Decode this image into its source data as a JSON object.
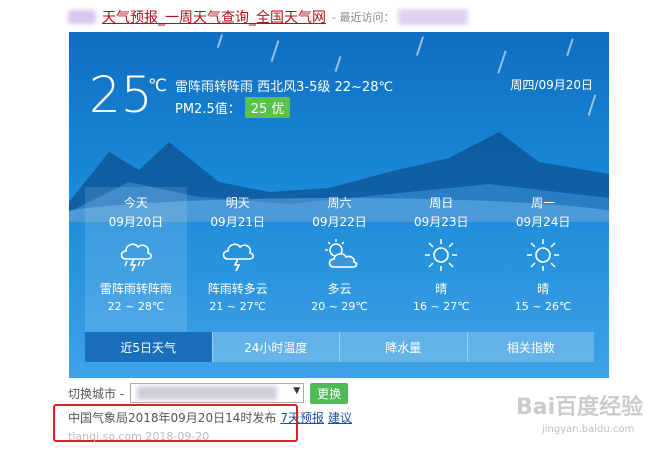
{
  "header": {
    "site_title": "天气预报_一周天气查询_全国天气网",
    "recent_label": "- 最近访问："
  },
  "current": {
    "temperature": "25",
    "unit": "℃",
    "summary": "雷阵雨转阵雨  西北风3-5级  22~28℃",
    "pm_label": "PM2.5值：",
    "pm_value": "25 优",
    "date": "周四/09月20日"
  },
  "forecast": [
    {
      "day": "今天",
      "date": "09月20日",
      "icon": "thunderstorm-icon",
      "desc": "雷阵雨转阵雨",
      "range": "22 ~ 28℃"
    },
    {
      "day": "明天",
      "date": "09月21日",
      "icon": "thunder-shower-icon",
      "desc": "阵雨转多云",
      "range": "21 ~ 27℃"
    },
    {
      "day": "周六",
      "date": "09月22日",
      "icon": "partly-cloudy-icon",
      "desc": "多云",
      "range": "20 ~ 29℃"
    },
    {
      "day": "周日",
      "date": "09月23日",
      "icon": "sunny-icon",
      "desc": "晴",
      "range": "16 ~ 27℃"
    },
    {
      "day": "周一",
      "date": "09月24日",
      "icon": "sunny-icon",
      "desc": "晴",
      "range": "15 ~ 26℃"
    }
  ],
  "tabs": [
    "近5日天气",
    "24小时温度",
    "降水量",
    "相关指数"
  ],
  "bottom": {
    "city_label": "切换城市 -",
    "switch_button": "更换",
    "publish_text": "中国气象局2018年09月20日14时发布",
    "link_forecast": "7天预报",
    "link_suggest": "建议",
    "site_url": "tianqi.so.com  2018-09-20"
  },
  "watermark": {
    "brand": "Bai百度经验",
    "url": "jingyan.baidu.com"
  },
  "colors": {
    "sky_top": "#0f6ec2",
    "sky_bottom": "#3ea2e6",
    "pm_badge": "#5ac04e",
    "highlight_border": "#d9232a",
    "title_red": "#b0121b"
  }
}
